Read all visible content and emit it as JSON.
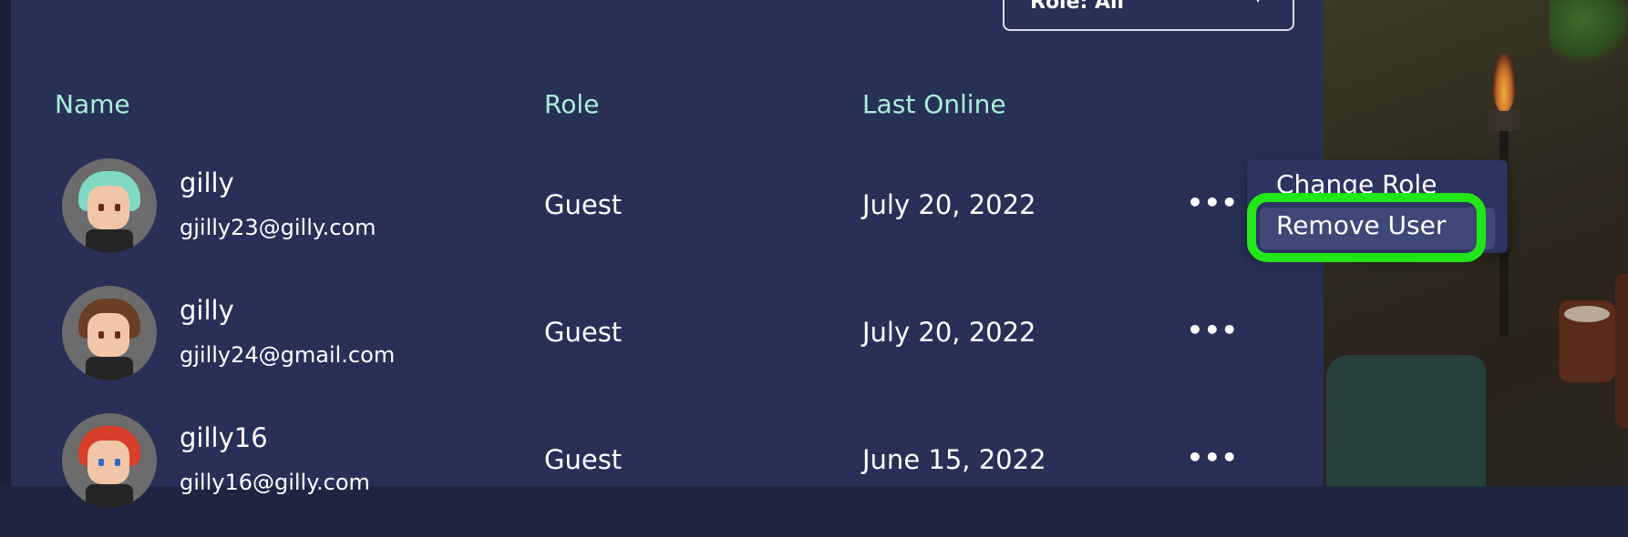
{
  "role_filter": {
    "label": "Role: All"
  },
  "columns": {
    "name": "Name",
    "role": "Role",
    "last_online": "Last Online"
  },
  "users": [
    {
      "name": "gilly",
      "email": "gjilly23@gilly.com",
      "role": "Guest",
      "last_online": "July 20, 2022",
      "hair_color": "#7fd9c4"
    },
    {
      "name": "gilly",
      "email": "gjilly24@gmail.com",
      "role": "Guest",
      "last_online": "July 20, 2022",
      "hair_color": "#6b3f26"
    },
    {
      "name": "gilly16",
      "email": "gilly16@gilly.com",
      "role": "Guest",
      "last_online": "June 15, 2022",
      "hair_color": "#d8402c"
    }
  ],
  "more_label": "•••",
  "context_menu": {
    "items": [
      "Change Role",
      "Remove User"
    ]
  },
  "colors": {
    "panel": "#283057",
    "header_text": "#a9f0d8",
    "highlight": "#22e61a"
  }
}
